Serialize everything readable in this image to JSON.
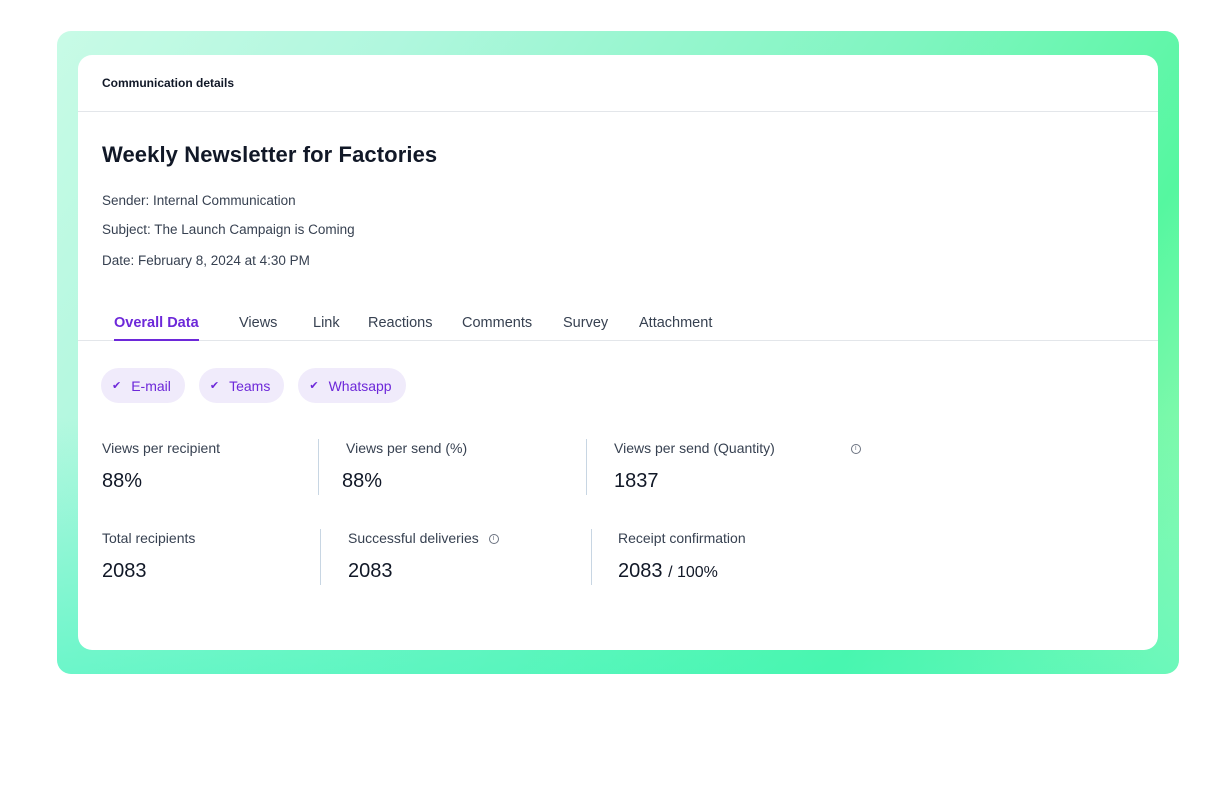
{
  "header": {
    "title": "Communication details"
  },
  "communication": {
    "title": "Weekly Newsletter for Factories",
    "sender": "Sender: Internal Communication",
    "subject": "Subject: The Launch Campaign is Coming",
    "date": "Date: February 8, 2024 at 4:30 PM"
  },
  "tabs": [
    {
      "label": "Overall Data",
      "active": true
    },
    {
      "label": "Views"
    },
    {
      "label": "Link"
    },
    {
      "label": "Reactions"
    },
    {
      "label": "Comments"
    },
    {
      "label": "Survey"
    },
    {
      "label": "Attachment"
    }
  ],
  "channels": [
    {
      "label": "E-mail",
      "checked": true
    },
    {
      "label": "Teams",
      "checked": true
    },
    {
      "label": "Whatsapp",
      "checked": true
    }
  ],
  "stats": {
    "views_per_recipient": {
      "label": "Views per recipient",
      "value": "88%"
    },
    "views_per_send_pct": {
      "label": "Views per send (%)",
      "value": "88%"
    },
    "views_per_send_qty": {
      "label": "Views per send (Quantity)",
      "value": "1837"
    },
    "total_recipients": {
      "label": "Total recipients",
      "value": "2083"
    },
    "successful_deliveries": {
      "label": "Successful deliveries",
      "value": "2083"
    },
    "receipt_confirmation": {
      "label": "Receipt confirmation",
      "value": "2083",
      "suffix": "/ 100%"
    }
  },
  "icons": {
    "check": "check-icon",
    "info": "info-icon"
  },
  "colors": {
    "accent": "#6d28d9",
    "chip_bg": "#f0ebfb",
    "frame_green": "#55f7a0"
  }
}
